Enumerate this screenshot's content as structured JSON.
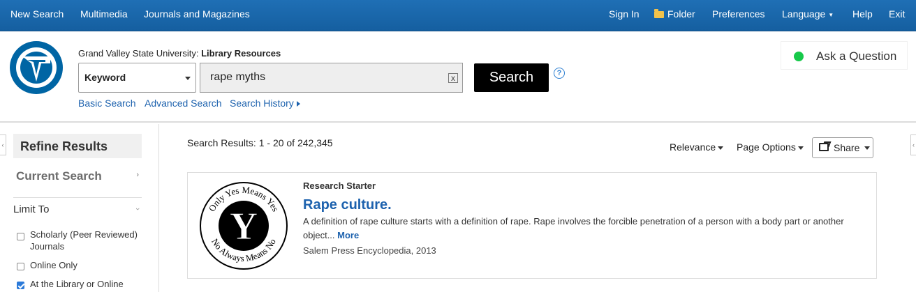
{
  "topnav": {
    "left": [
      "New Search",
      "Multimedia",
      "Journals and Magazines"
    ],
    "sign_in": "Sign In",
    "folder": "Folder",
    "preferences": "Preferences",
    "language": "Language",
    "help": "Help",
    "exit": "Exit"
  },
  "header": {
    "institution": "Grand Valley State University:",
    "resource": "Library Resources",
    "field_select": "Keyword",
    "query": "rape myths",
    "clear_glyph": "x",
    "search_button": "Search",
    "help_glyph": "?",
    "links": [
      "Basic Search",
      "Advanced Search",
      "Search History"
    ],
    "ask": "Ask a Question"
  },
  "sidebar": {
    "title": "Refine Results",
    "current_search": "Current Search",
    "limit_to": "Limit To",
    "limits": [
      {
        "label": "Scholarly (Peer Reviewed) Journals",
        "checked": false
      },
      {
        "label": "Online Only",
        "checked": false
      },
      {
        "label": "At the Library or Online",
        "checked": true
      }
    ]
  },
  "results": {
    "count_text": "Search Results: 1 - 20 of 242,345",
    "sort": "Relevance",
    "page_options": "Page Options",
    "share": "Share",
    "items": [
      {
        "type": "Research Starter",
        "title": "Rape culture.",
        "description": "A definition of rape culture starts with a definition of rape. Rape involves the forcible penetration of a person with a body part or another object...",
        "more": "More",
        "source": "Salem Press Encyclopedia, 2013",
        "emblem_top": "Only Yes Means Yes",
        "emblem_bottom": "No Always Means No",
        "emblem_letter": "Y"
      }
    ]
  },
  "colors": {
    "nav_blue": "#1f6fb5",
    "link_blue": "#1d62ae",
    "status_green": "#17c94a",
    "gvsu_blue": "#0065a4"
  }
}
